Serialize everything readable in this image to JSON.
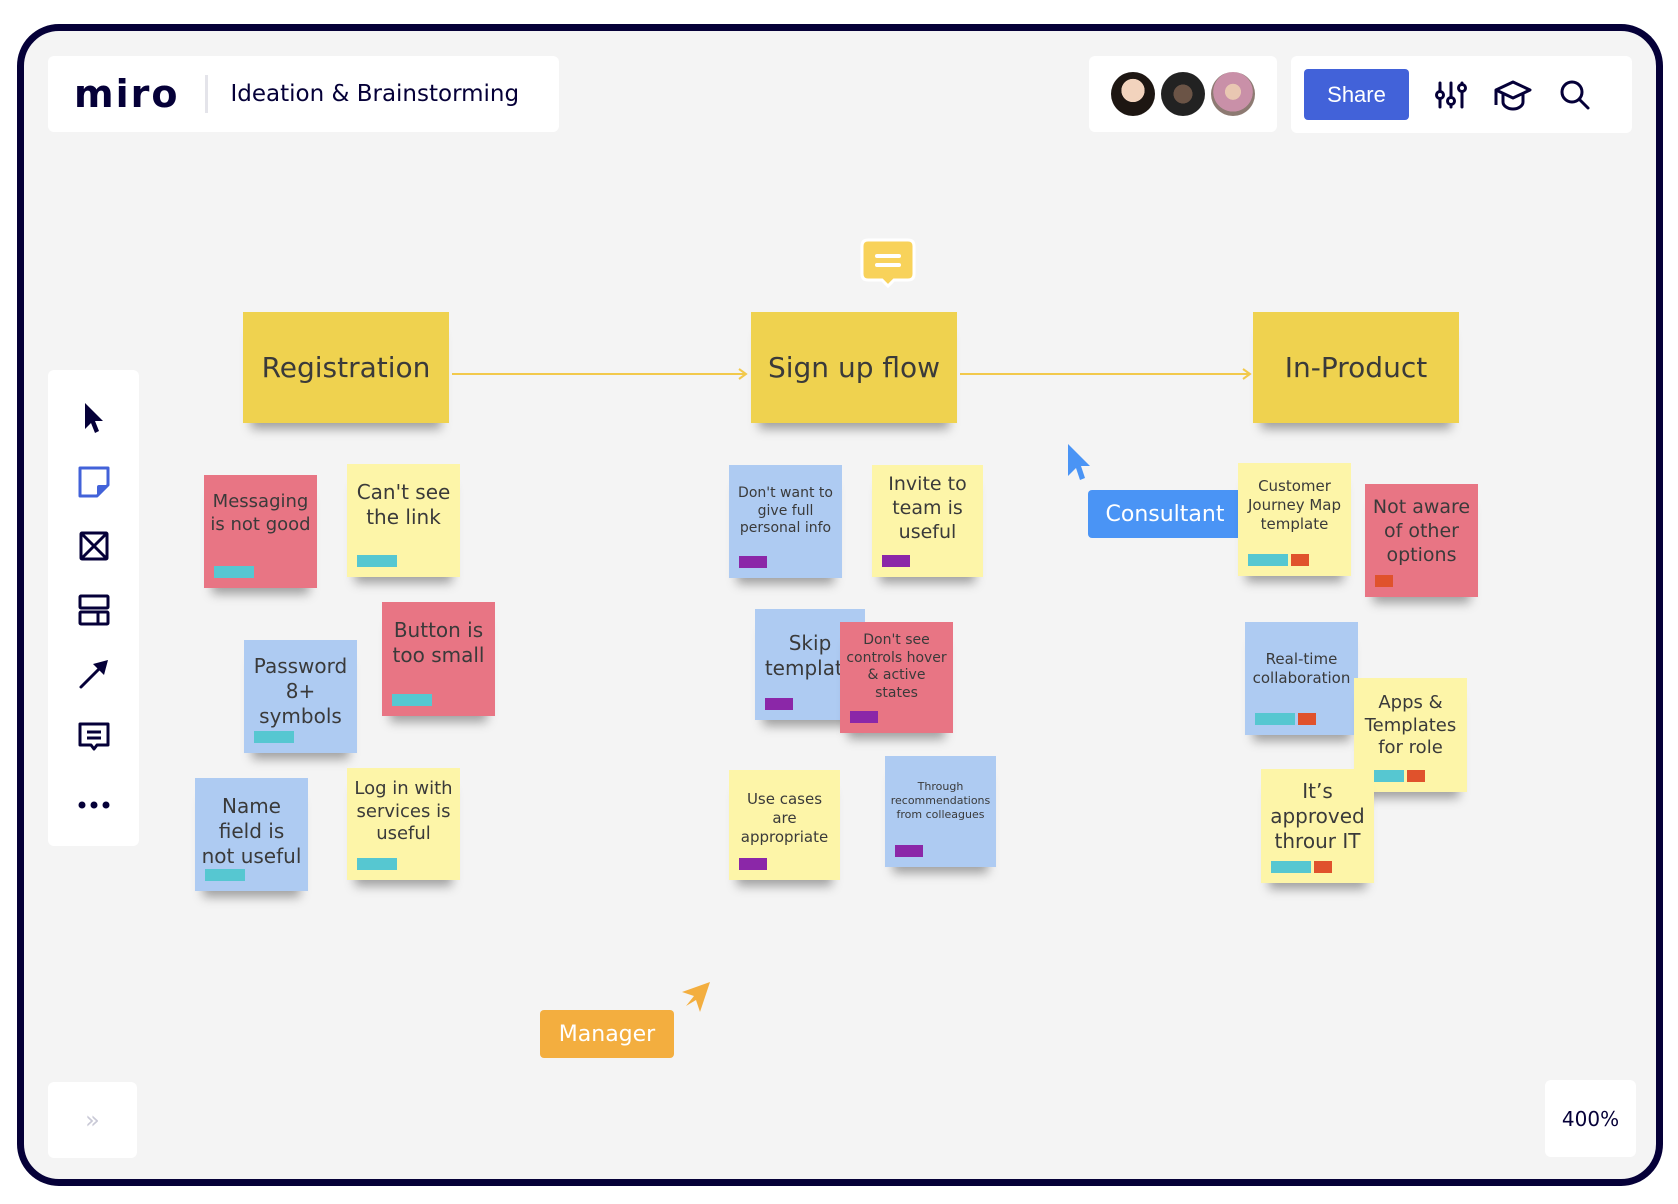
{
  "header": {
    "logo": "miro",
    "board_title": "Ideation & Brainstorming"
  },
  "collaborators": [
    {
      "name": "collaborator-1",
      "color": "#e8c2a4"
    },
    {
      "name": "collaborator-2",
      "color": "#2b2b2b"
    },
    {
      "name": "collaborator-3",
      "color": "#c9a2ae"
    }
  ],
  "toolbar": {
    "share_label": "Share",
    "icons": [
      "settings-sliders-icon",
      "learning-cap-icon",
      "search-icon"
    ]
  },
  "left_tools": [
    {
      "name": "select-tool",
      "icon": "cursor-icon",
      "active": false
    },
    {
      "name": "sticky-note-tool",
      "icon": "sticky-note-icon",
      "active": true
    },
    {
      "name": "frame-tool",
      "icon": "frame-icon",
      "active": false
    },
    {
      "name": "templates-tool",
      "icon": "templates-icon",
      "active": false
    },
    {
      "name": "connection-line-tool",
      "icon": "arrow-icon",
      "active": false
    },
    {
      "name": "comment-tool",
      "icon": "comment-icon",
      "active": false
    },
    {
      "name": "more-tools",
      "icon": "more-icon",
      "active": false
    }
  ],
  "zoom_level": "400%",
  "expand_label": "»",
  "colors": {
    "accent": "#4262d9",
    "frame_border": "#050038",
    "sticky_yellow": "#fdf5a8",
    "sticky_header": "#efd24f",
    "sticky_pink": "#e87584",
    "sticky_blue": "#aecbf2",
    "tag_cyan": "#56c7d1",
    "tag_purple": "#8b27a8",
    "tag_red": "#e0522c",
    "consultant": "#4a94f5",
    "manager": "#f3ae3f"
  },
  "board": {
    "headers": [
      {
        "id": "registration",
        "label": "Registration"
      },
      {
        "id": "signup",
        "label": "Sign up flow"
      },
      {
        "id": "inproduct",
        "label": "In-Product"
      }
    ],
    "stickies": [
      {
        "text": "Messaging is not good",
        "color": "pink",
        "tags": [
          "cyan"
        ]
      },
      {
        "text": "Can't see the link",
        "color": "yellow",
        "tags": [
          "cyan"
        ]
      },
      {
        "text": "Password 8+ symbols",
        "color": "blue",
        "tags": [
          "cyan"
        ]
      },
      {
        "text": "Button is too small",
        "color": "pink",
        "tags": [
          "cyan"
        ]
      },
      {
        "text": "Name field is not useful",
        "color": "blue",
        "tags": [
          "cyan"
        ]
      },
      {
        "text": "Log in with services is useful",
        "color": "yellow",
        "tags": [
          "cyan"
        ]
      },
      {
        "text": "Don't want to give full personal info",
        "color": "blue",
        "tags": [
          "purple"
        ]
      },
      {
        "text": "Invite to team is useful",
        "color": "yellow",
        "tags": [
          "purple"
        ]
      },
      {
        "text": "Skip template",
        "color": "blue",
        "tags": [
          "purple"
        ]
      },
      {
        "text": "Don't see controls hover & active states",
        "color": "pink",
        "tags": [
          "purple"
        ]
      },
      {
        "text": "Use cases are appropriate",
        "color": "yellow",
        "tags": [
          "purple"
        ]
      },
      {
        "text": "Through recommendations from colleagues",
        "color": "blue",
        "tags": [
          "purple"
        ]
      },
      {
        "text": "Customer Journey Map template",
        "color": "yellow",
        "tags": [
          "cyan",
          "red"
        ]
      },
      {
        "text": "Not aware of other options",
        "color": "pink",
        "tags": [
          "red"
        ]
      },
      {
        "text": "Real-time collaboration",
        "color": "blue",
        "tags": [
          "cyan",
          "red"
        ]
      },
      {
        "text": "Apps  & Templates for role",
        "color": "yellow",
        "tags": [
          "cyan",
          "red"
        ]
      },
      {
        "text": "It’s approved throur IT",
        "color": "yellow",
        "tags": [
          "cyan",
          "red"
        ]
      }
    ]
  },
  "cursors": [
    {
      "label": "Consultant",
      "color": "#4a94f5"
    },
    {
      "label": "Manager",
      "color": "#f3ae3f"
    }
  ]
}
